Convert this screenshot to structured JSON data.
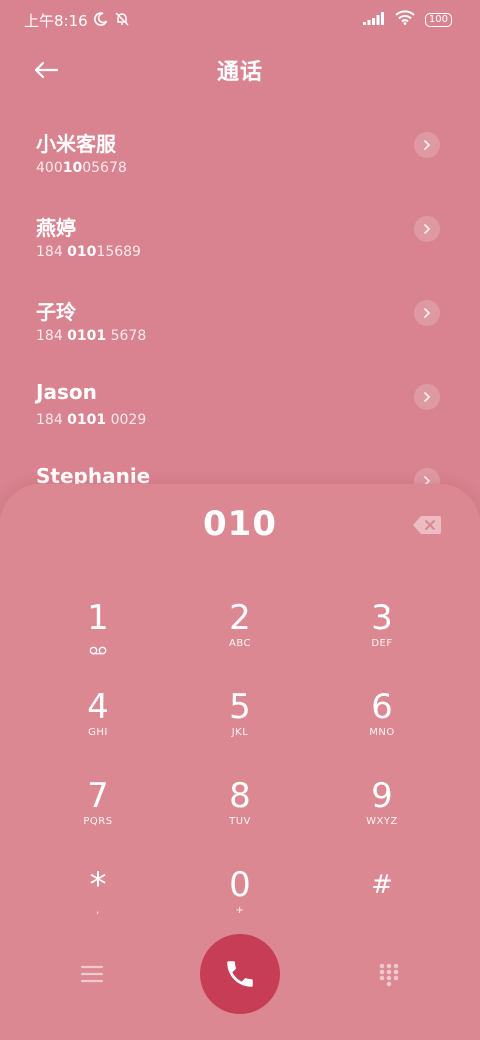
{
  "status_bar": {
    "time": "上午8:16",
    "battery": "100"
  },
  "header": {
    "title": "通话"
  },
  "contacts": [
    {
      "name": "小米客服",
      "number_pre": "400",
      "number_match": "10",
      "number_post": "05678"
    },
    {
      "name": "燕婷",
      "number_pre": "184 ",
      "number_match": "010",
      "number_post": "15689"
    },
    {
      "name": "子玲",
      "number_pre": "184 ",
      "number_match": "0101",
      "number_post": " 5678"
    },
    {
      "name": "Jason",
      "number_pre": "184 ",
      "number_match": "0101",
      "number_post": " 0029"
    },
    {
      "name": "Stephanie",
      "number_pre": "",
      "number_match": "",
      "number_post": ""
    }
  ],
  "dialer": {
    "number": "010",
    "keys": [
      {
        "digit": "1",
        "letters": ""
      },
      {
        "digit": "2",
        "letters": "ABC"
      },
      {
        "digit": "3",
        "letters": "DEF"
      },
      {
        "digit": "4",
        "letters": "GHI"
      },
      {
        "digit": "5",
        "letters": "JKL"
      },
      {
        "digit": "6",
        "letters": "MNO"
      },
      {
        "digit": "7",
        "letters": "PQRS"
      },
      {
        "digit": "8",
        "letters": "TUV"
      },
      {
        "digit": "9",
        "letters": "WXYZ"
      },
      {
        "digit": "*",
        "letters": ","
      },
      {
        "digit": "0",
        "letters": "+"
      },
      {
        "digit": "#",
        "letters": ""
      }
    ]
  },
  "colors": {
    "background": "#d8838f",
    "call_button": "#c63d55"
  }
}
